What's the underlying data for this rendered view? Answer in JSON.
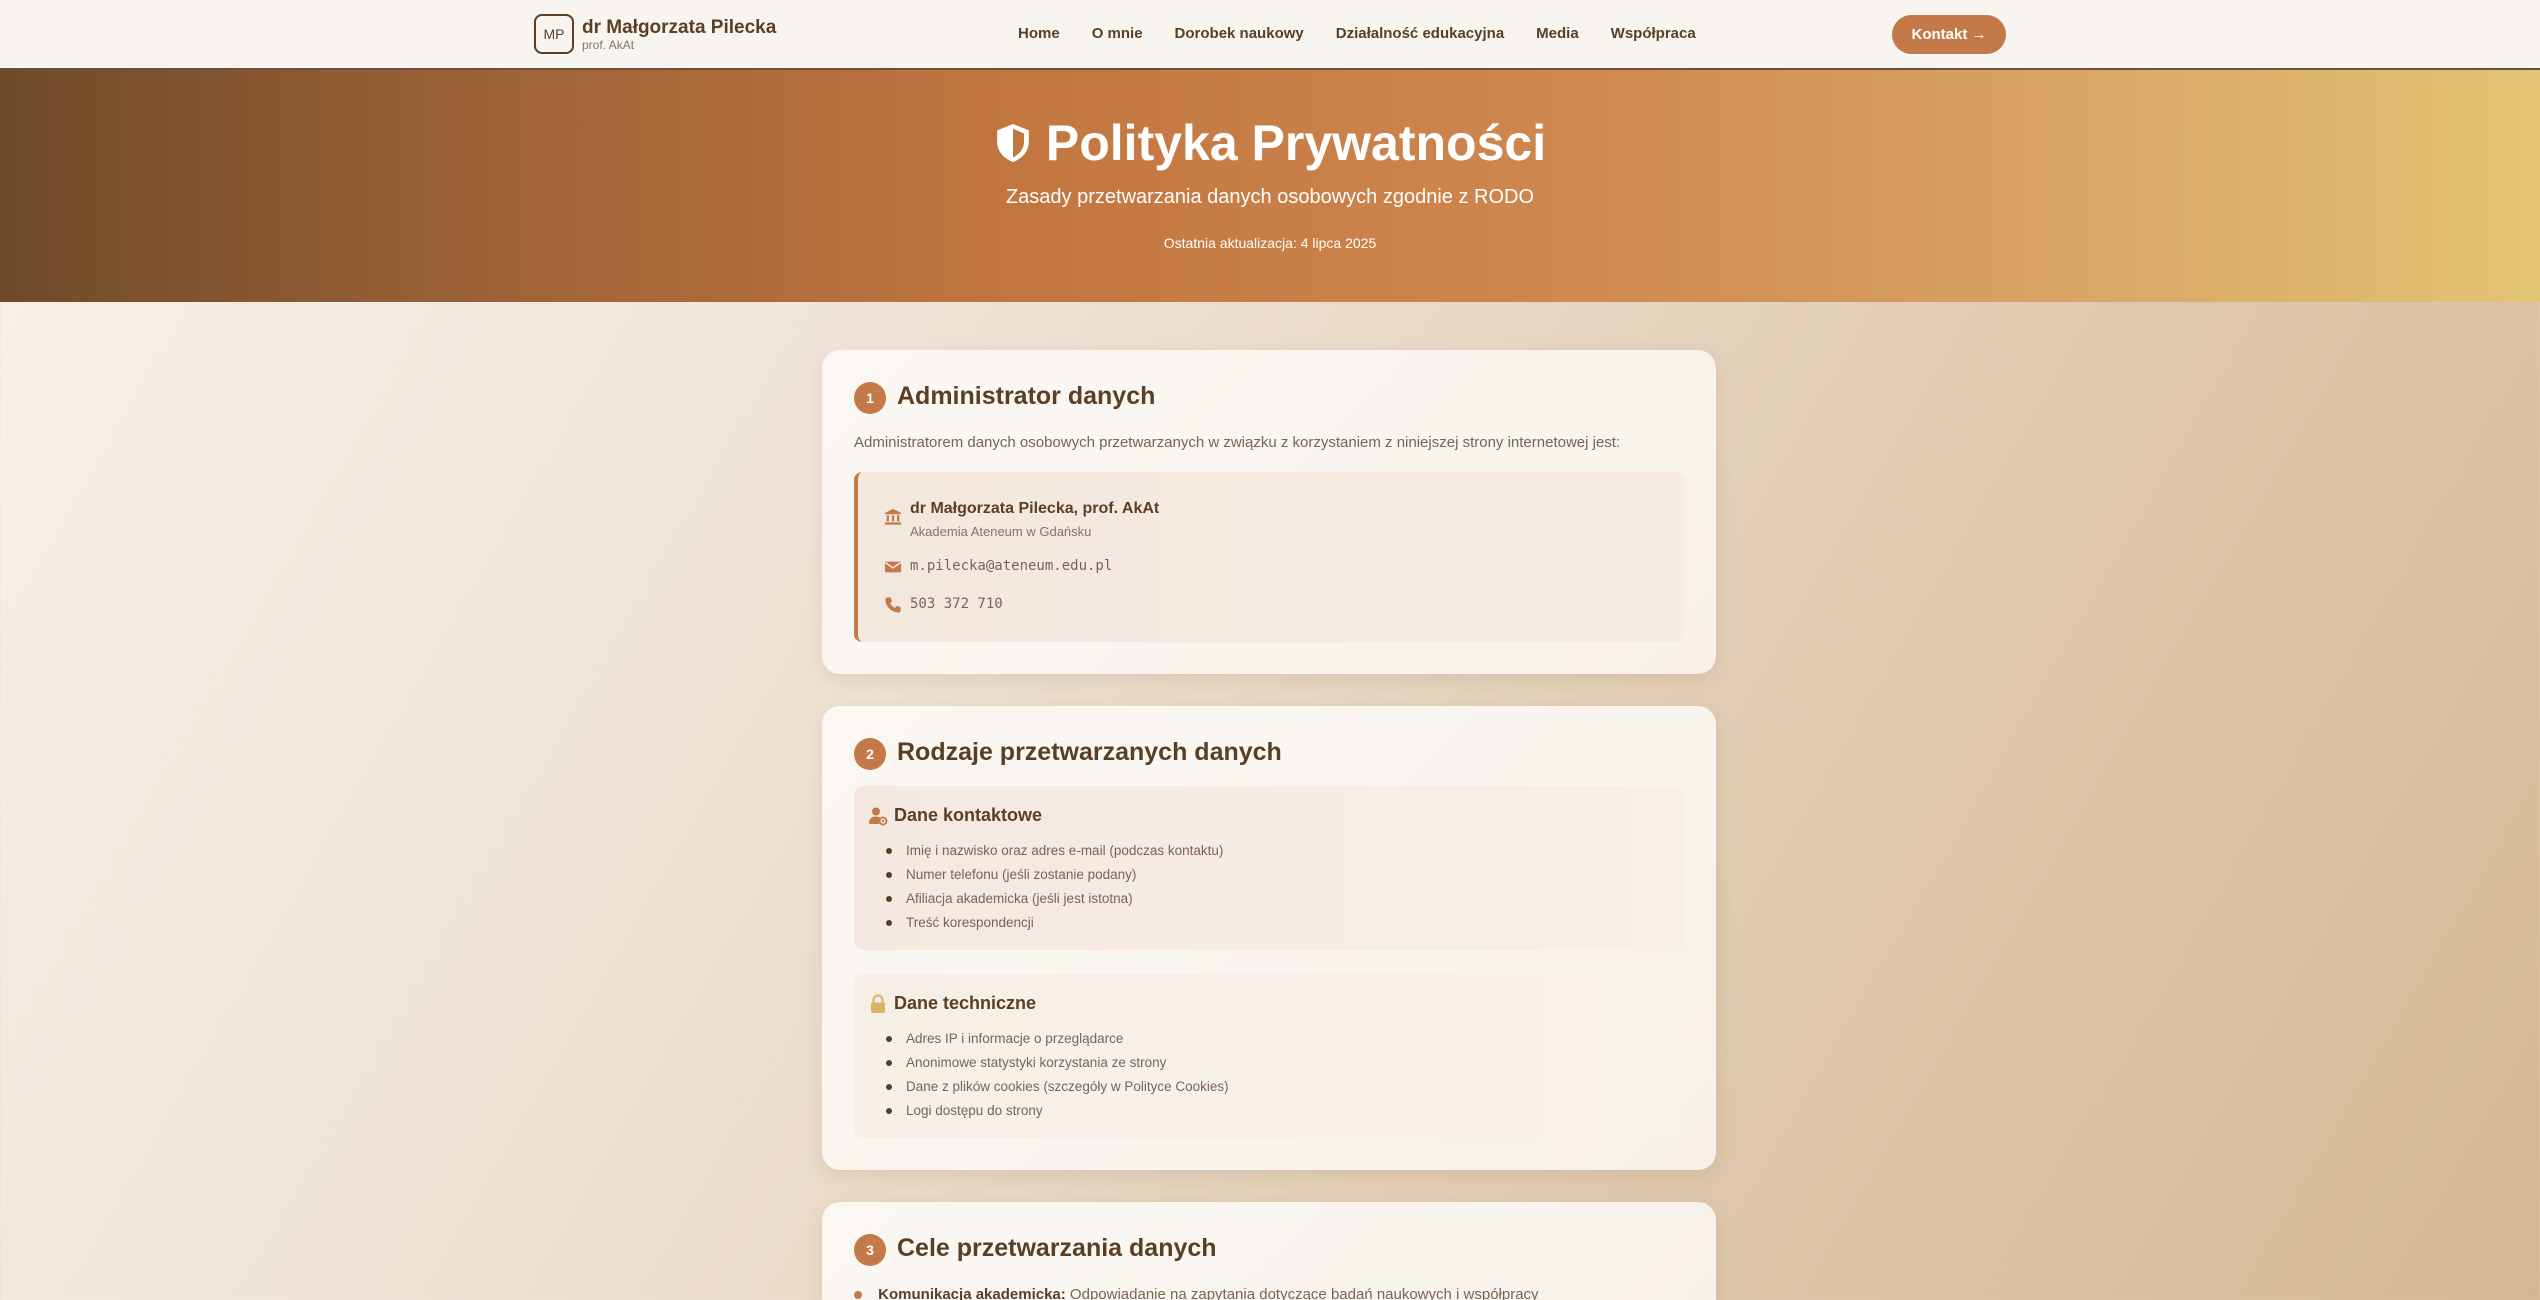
{
  "nav": {
    "logo_initials": "MP",
    "logo_name": "dr Małgorzata Pilecka",
    "logo_sub": "prof. AkAt",
    "links": [
      "Home",
      "O mnie",
      "Dorobek naukowy",
      "Działalność edukacyjna",
      "Media",
      "Współpraca"
    ],
    "contact_label": "Kontakt →"
  },
  "hero": {
    "title": "Polityka Prywatności",
    "subtitle": "Zasady przetwarzania danych osobowych zgodnie z RODO",
    "updated": "Ostatnia aktualizacja: 4 lipca 2025"
  },
  "sections": [
    {
      "number": "1",
      "title": "Administrator danych",
      "intro": "Administratorem danych osobowych przetwarzanych w związku z korzystaniem z niniejszej strony internetowej jest:",
      "admin": {
        "name": "dr Małgorzata Pilecka, prof. AkAt",
        "org": "Akademia Ateneum w Gdańsku",
        "email": "m.pilecka@ateneum.edu.pl",
        "phone": "503 372 710"
      }
    },
    {
      "number": "2",
      "title": "Rodzaje przetwarzanych danych",
      "boxes": [
        {
          "title": "Dane kontaktowe",
          "items": [
            "Imię i nazwisko oraz adres e-mail (podczas kontaktu)",
            "Numer telefonu (jeśli zostanie podany)",
            "Afiliacja akademicka (jeśli jest istotna)",
            "Treść korespondencji"
          ]
        },
        {
          "title": "Dane techniczne",
          "items": [
            "Adres IP i informacje o przeglądarce",
            "Anonimowe statystyki korzystania ze strony",
            "Dane z plików cookies (szczegóły w Polityce Cookies)",
            "Logi dostępu do strony"
          ]
        }
      ]
    },
    {
      "number": "3",
      "title": "Cele przetwarzania danych",
      "first_goal_label": "Komunikacja akademicka:",
      "first_goal_text": " Odpowiadanie na zapytania dotyczące badań naukowych i współpracy"
    }
  ],
  "colors": {
    "accent": "#c37a48",
    "text_dark": "#5a3e26",
    "text_muted": "#7a6453"
  }
}
